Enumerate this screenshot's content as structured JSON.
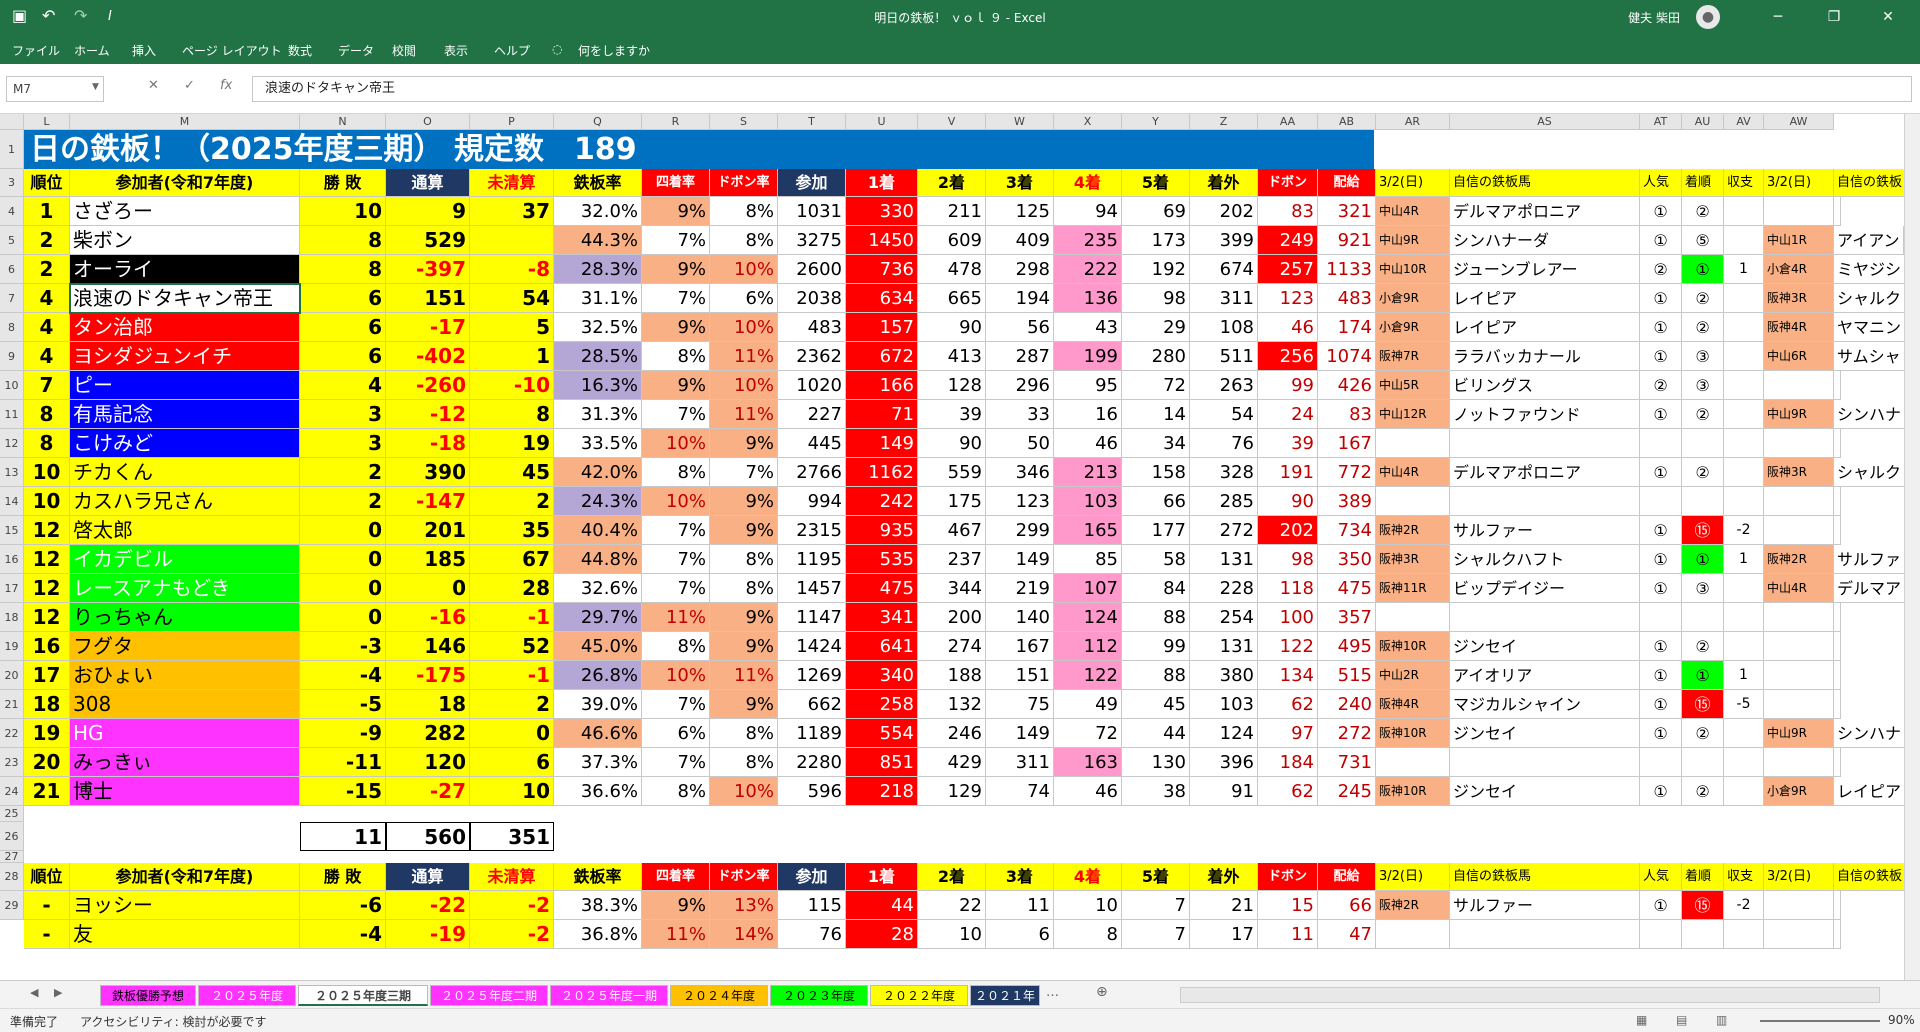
{
  "titlebar": {
    "title": "明日の鉄板！ ｖｏｌ ９ - Excel",
    "user": "健夫 柴田",
    "min": "─",
    "restore": "❐",
    "close": "✕",
    "save_icon": "save-icon",
    "undo": "↶",
    "redo": "↷",
    "italic": "I"
  },
  "ribbon": {
    "tabs": [
      "ファイル",
      "ホーム",
      "挿入",
      "ページ レイアウト",
      "数式",
      "データ",
      "校閲",
      "表示",
      "ヘルプ"
    ],
    "tell": "何をしますか"
  },
  "formulabar": {
    "namebox": "M7",
    "fx": "fx",
    "value": "浪速のドタキャン帝王"
  },
  "columns": [
    "L",
    "M",
    "N",
    "O",
    "P",
    "Q",
    "R",
    "S",
    "T",
    "U",
    "V",
    "W",
    "X",
    "Y",
    "Z",
    "AA",
    "AB",
    "AR",
    "AS",
    "AT",
    "AU",
    "AV",
    "AW"
  ],
  "rows": [
    "1",
    "3",
    "4",
    "5",
    "6",
    "7",
    "8",
    "9",
    "10",
    "11",
    "12",
    "13",
    "14",
    "15",
    "16",
    "17",
    "18",
    "19",
    "20",
    "21",
    "22",
    "23",
    "24",
    "25",
    "26",
    "27",
    "28",
    "29"
  ],
  "banner": "日の鉄板！（2025年度三期） 規定数　189",
  "header": [
    "順位",
    "参加者(令和7年度)",
    "勝 敗",
    "通算",
    "未清算",
    "鉄板率",
    "四着率",
    "ドボン率",
    "参加",
    "1着",
    "2着",
    "3着",
    "4着",
    "5着",
    "着外",
    "ドボン",
    "配給",
    "3/2(日)",
    "自信の鉄板馬",
    "人気",
    "着順",
    "収支",
    "3/2(日)",
    "自信の鉄板"
  ],
  "table": [
    [
      "1",
      "さざろー",
      "10",
      "9",
      "37",
      "32.0%",
      "9%",
      "8%",
      "1031",
      "330",
      "211",
      "125",
      "94",
      "69",
      "202",
      "83",
      "321",
      "中山4R",
      "デルマアポロニア",
      "①",
      "②",
      "",
      "",
      ""
    ],
    [
      "2",
      "柴ボン",
      "8",
      "529",
      "",
      "44.3%",
      "7%",
      "8%",
      "3275",
      "1450",
      "609",
      "409",
      "235",
      "173",
      "399",
      "249",
      "921",
      "中山9R",
      "シンハナーダ",
      "①",
      "⑤",
      "",
      "中山1R",
      "アイアン"
    ],
    [
      "2",
      "オーライ",
      "8",
      "-397",
      "-8",
      "28.3%",
      "9%",
      "10%",
      "2600",
      "736",
      "478",
      "298",
      "222",
      "192",
      "674",
      "257",
      "1133",
      "中山10R",
      "ジューンブレアー",
      "②",
      "①",
      "1",
      "小倉4R",
      "ミヤジシ"
    ],
    [
      "4",
      "浪速のドタキャン帝王",
      "6",
      "151",
      "54",
      "31.1%",
      "7%",
      "6%",
      "2038",
      "634",
      "665",
      "194",
      "136",
      "98",
      "311",
      "123",
      "483",
      "小倉9R",
      "レイピア",
      "①",
      "②",
      "",
      "阪神3R",
      "シャルク"
    ],
    [
      "4",
      "タン治郎",
      "6",
      "-17",
      "5",
      "32.5%",
      "9%",
      "10%",
      "483",
      "157",
      "90",
      "56",
      "43",
      "29",
      "108",
      "46",
      "174",
      "小倉9R",
      "レイピア",
      "①",
      "②",
      "",
      "阪神4R",
      "ヤマニン"
    ],
    [
      "4",
      "ヨシダジュンイチ",
      "6",
      "-402",
      "1",
      "28.5%",
      "8%",
      "11%",
      "2362",
      "672",
      "413",
      "287",
      "199",
      "280",
      "511",
      "256",
      "1074",
      "阪神7R",
      "ララバッカナール",
      "①",
      "③",
      "",
      "中山6R",
      "サムシャ"
    ],
    [
      "7",
      "ピー",
      "4",
      "-260",
      "-10",
      "16.3%",
      "9%",
      "10%",
      "1020",
      "166",
      "128",
      "296",
      "95",
      "72",
      "263",
      "99",
      "426",
      "中山5R",
      "ビリングス",
      "②",
      "③",
      "",
      "",
      ""
    ],
    [
      "8",
      "有馬記念",
      "3",
      "-12",
      "8",
      "31.3%",
      "7%",
      "11%",
      "227",
      "71",
      "39",
      "33",
      "16",
      "14",
      "54",
      "24",
      "83",
      "中山12R",
      "ノットファウンド",
      "①",
      "②",
      "",
      "中山9R",
      "シンハナ"
    ],
    [
      "8",
      "こけみど",
      "3",
      "-18",
      "19",
      "33.5%",
      "10%",
      "9%",
      "445",
      "149",
      "90",
      "50",
      "46",
      "34",
      "76",
      "39",
      "167",
      "",
      "",
      "",
      "",
      "",
      "",
      ""
    ],
    [
      "10",
      "チカくん",
      "2",
      "390",
      "45",
      "42.0%",
      "8%",
      "7%",
      "2766",
      "1162",
      "559",
      "346",
      "213",
      "158",
      "328",
      "191",
      "772",
      "中山4R",
      "デルマアポロニア",
      "①",
      "②",
      "",
      "阪神3R",
      "シャルク"
    ],
    [
      "10",
      "カスハラ兄さん",
      "2",
      "-147",
      "2",
      "24.3%",
      "10%",
      "9%",
      "994",
      "242",
      "175",
      "123",
      "103",
      "66",
      "285",
      "90",
      "389",
      "",
      "",
      "",
      "",
      "",
      "",
      ""
    ],
    [
      "12",
      "啓太郎",
      "0",
      "201",
      "35",
      "40.4%",
      "7%",
      "9%",
      "2315",
      "935",
      "467",
      "299",
      "165",
      "177",
      "272",
      "202",
      "734",
      "阪神2R",
      "サルファー",
      "①",
      "⑮",
      "-2",
      "",
      ""
    ],
    [
      "12",
      "イカデビル",
      "0",
      "185",
      "67",
      "44.8%",
      "7%",
      "8%",
      "1195",
      "535",
      "237",
      "149",
      "85",
      "58",
      "131",
      "98",
      "350",
      "阪神3R",
      "シャルクハフト",
      "①",
      "①",
      "1",
      "阪神2R",
      "サルファ"
    ],
    [
      "12",
      "レースアナもどき",
      "0",
      "0",
      "28",
      "32.6%",
      "7%",
      "8%",
      "1457",
      "475",
      "344",
      "219",
      "107",
      "84",
      "228",
      "118",
      "475",
      "阪神11R",
      "ビップデイジー",
      "①",
      "③",
      "",
      "中山4R",
      "デルマア"
    ],
    [
      "12",
      "りっちゃん",
      "0",
      "-16",
      "-1",
      "29.7%",
      "11%",
      "9%",
      "1147",
      "341",
      "200",
      "140",
      "124",
      "88",
      "254",
      "100",
      "357",
      "",
      "",
      "",
      "",
      "",
      "",
      ""
    ],
    [
      "16",
      "フグタ",
      "-3",
      "146",
      "52",
      "45.0%",
      "8%",
      "9%",
      "1424",
      "641",
      "274",
      "167",
      "112",
      "99",
      "131",
      "122",
      "495",
      "阪神10R",
      "ジンセイ",
      "①",
      "②",
      "",
      "",
      ""
    ],
    [
      "17",
      "おひょい",
      "-4",
      "-175",
      "-1",
      "26.8%",
      "10%",
      "11%",
      "1269",
      "340",
      "188",
      "151",
      "122",
      "88",
      "380",
      "134",
      "515",
      "中山2R",
      "アイオリア",
      "①",
      "①",
      "1",
      "",
      ""
    ],
    [
      "18",
      "308",
      "-5",
      "18",
      "2",
      "39.0%",
      "7%",
      "9%",
      "662",
      "258",
      "132",
      "75",
      "49",
      "45",
      "103",
      "62",
      "240",
      "阪神4R",
      "マジカルシャイン",
      "①",
      "⑮",
      "-5",
      "",
      ""
    ],
    [
      "19",
      "HG",
      "-9",
      "282",
      "0",
      "46.6%",
      "6%",
      "8%",
      "1189",
      "554",
      "246",
      "149",
      "72",
      "44",
      "124",
      "97",
      "272",
      "阪神10R",
      "ジンセイ",
      "①",
      "②",
      "",
      "中山9R",
      "シンハナ"
    ],
    [
      "20",
      "みっきぃ",
      "-11",
      "120",
      "6",
      "37.3%",
      "7%",
      "8%",
      "2280",
      "851",
      "429",
      "311",
      "163",
      "130",
      "396",
      "184",
      "731",
      "",
      "",
      "",
      "",
      "",
      "",
      ""
    ],
    [
      "21",
      "博士",
      "-15",
      "-27",
      "10",
      "36.6%",
      "8%",
      "10%",
      "596",
      "218",
      "129",
      "74",
      "46",
      "38",
      "91",
      "62",
      "245",
      "阪神10R",
      "ジンセイ",
      "①",
      "②",
      "",
      "小倉9R",
      "レイピア"
    ]
  ],
  "totals": [
    "11",
    "560",
    "351"
  ],
  "bottom_row": [
    "-",
    "ヨッシー",
    "-6",
    "-22",
    "-2",
    "38.3%",
    "9%",
    "13%",
    "115",
    "44",
    "22",
    "11",
    "10",
    "7",
    "21",
    "15",
    "66",
    "阪神2R",
    "サルファー",
    "①",
    "⑮",
    "-2",
    "",
    ""
  ],
  "partial_row": [
    "-",
    "友",
    "-4",
    "-19",
    "-2",
    "36.8%",
    "11%",
    "14%",
    "76",
    "28",
    "10",
    "6",
    "8",
    "7",
    "17",
    "11",
    "47",
    "",
    "",
    "",
    "",
    "",
    "",
    ""
  ],
  "tabs": [
    "鉄板優勝予想",
    "２０２５年度",
    "２０２５年度三期",
    "２０２５年度二期",
    "２０２５年度一期",
    "２０２４年度",
    "２０２３年度",
    "２０２２年度",
    "２０２１年"
  ],
  "status": {
    "ready": "準備完了",
    "accessibility": "アクセシビリティ: 検討が必要です",
    "zoom": "90%"
  },
  "colors": {
    "excel_green": "#217346",
    "banner": "#0070c0",
    "yellow": "#ffff00",
    "red": "#ff0000",
    "pink": "#ff99cc",
    "salmon": "#f8b084",
    "purple": "#b4a7d6",
    "navy": "#1f3864",
    "green": "#00ff00",
    "orange": "#ffc000",
    "magenta": "#ff33ff",
    "blue": "#0000ff"
  }
}
